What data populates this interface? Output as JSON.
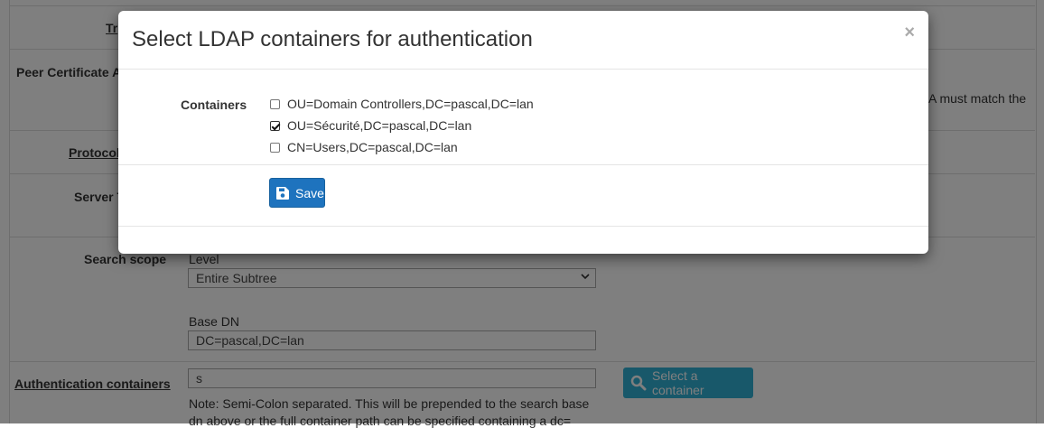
{
  "background": {
    "rows": [
      {
        "label": "Tr",
        "underlined": true
      },
      {
        "label": "Peer Certificate A",
        "underlined": false
      },
      {
        "label": "Protocol",
        "underlined": true
      },
      {
        "label": "Server T",
        "underlined": false
      },
      {
        "label": "Search scope",
        "underlined": false
      },
      {
        "label": "Authentication containers",
        "underlined": true
      }
    ],
    "peer_note_fragment": "A must match the",
    "level_label": "Level",
    "level_value": "Entire Subtree",
    "base_dn_label": "Base DN",
    "base_dn_value": "DC=pascal,DC=lan",
    "auth_containers_value": "s",
    "select_container_label": "Select a container",
    "note_line1": "Note: Semi-Colon separated. This will be prepended to the search base",
    "note_line2": "dn above or the full container path can be specified containing a dc="
  },
  "modal": {
    "title": "Select LDAP containers for authentication",
    "close_label": "×",
    "containers_label": "Containers",
    "options": [
      {
        "label": "OU=Domain Controllers,DC=pascal,DC=lan",
        "checked": false
      },
      {
        "label": "OU=Sécurité,DC=pascal,DC=lan",
        "checked": true
      },
      {
        "label": "CN=Users,DC=pascal,DC=lan",
        "checked": false
      }
    ],
    "save_label": "Save"
  },
  "colors": {
    "save_button": "#1e73be",
    "select_container_button": "#31b0d5",
    "overlay": "rgba(0,0,0,0.5)"
  },
  "icons": {
    "save": "floppy-disk-icon",
    "search": "magnifier-icon",
    "close": "close-icon"
  }
}
